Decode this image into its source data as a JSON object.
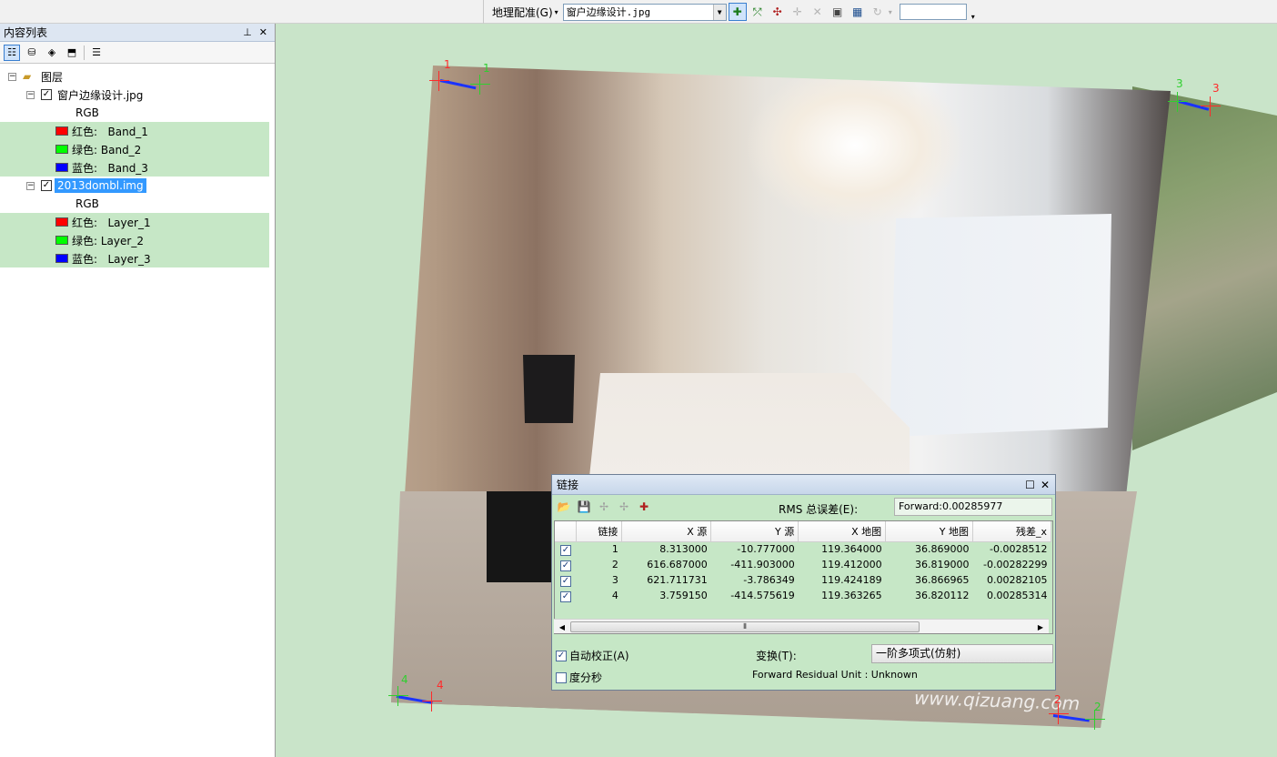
{
  "toolbar": {
    "georef_menu": "地理配准(G)",
    "layer_select": "窗户边缘设计.jpg",
    "scale_value": ""
  },
  "toc": {
    "title": "内容列表",
    "root": "图层",
    "layers": [
      {
        "name": "窗户边缘设计.jpg",
        "checked": true,
        "render": "RGB",
        "bands": [
          {
            "channel": "红色:",
            "value": "Band_1",
            "color": "#ff0000"
          },
          {
            "channel": "绿色:",
            "value": "Band_2",
            "color": "#00ff00"
          },
          {
            "channel": "蓝色:",
            "value": "Band_3",
            "color": "#0000ff"
          }
        ]
      },
      {
        "name": "2013dombl.img",
        "checked": true,
        "render": "RGB",
        "bands": [
          {
            "channel": "红色:",
            "value": "Layer_1",
            "color": "#ff0000"
          },
          {
            "channel": "绿色:",
            "value": "Layer_2",
            "color": "#00ff00"
          },
          {
            "channel": "蓝色:",
            "value": "Layer_3",
            "color": "#0000ff"
          }
        ]
      }
    ]
  },
  "map": {
    "watermark": "www.qizuang.com",
    "gcps": [
      {
        "src": "1",
        "dst": "1"
      },
      {
        "src": "3",
        "dst": "3"
      },
      {
        "src": "4",
        "dst": "4"
      },
      {
        "src": "2",
        "dst": "2"
      }
    ]
  },
  "link_dialog": {
    "title": "链接",
    "rms_label": "RMS 总误差(E):",
    "rms_value": "Forward:0.00285977",
    "columns": [
      "链接",
      "X 源",
      "Y 源",
      "X 地图",
      "Y 地图",
      "残差_x"
    ],
    "rows": [
      {
        "checked": true,
        "id": "1",
        "x_src": "8.313000",
        "y_src": "-10.777000",
        "x_map": "119.364000",
        "y_map": "36.869000",
        "res_x": "-0.0028512"
      },
      {
        "checked": true,
        "id": "2",
        "x_src": "616.687000",
        "y_src": "-411.903000",
        "x_map": "119.412000",
        "y_map": "36.819000",
        "res_x": "-0.00282299"
      },
      {
        "checked": true,
        "id": "3",
        "x_src": "621.711731",
        "y_src": "-3.786349",
        "x_map": "119.424189",
        "y_map": "36.866965",
        "res_x": "0.00282105"
      },
      {
        "checked": true,
        "id": "4",
        "x_src": "3.759150",
        "y_src": "-414.575619",
        "x_map": "119.363265",
        "y_map": "36.820112",
        "res_x": "0.00285314"
      }
    ],
    "auto_adjust_label": "自动校正(A)",
    "auto_adjust_checked": true,
    "dms_label": "度分秒",
    "dms_checked": false,
    "transform_label": "变换(T):",
    "transform_value": "一阶多项式(仿射)",
    "residual_unit": "Forward Residual Unit : Unknown"
  }
}
